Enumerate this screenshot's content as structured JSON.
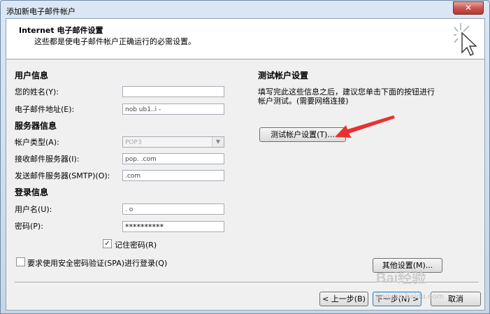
{
  "window": {
    "title": "添加新电子邮件帐户",
    "close_glyph": "✕"
  },
  "header": {
    "title": "Internet 电子邮件设置",
    "subtitle": "这些都是使电子邮件帐户正确运行的必需设置。"
  },
  "user_info": {
    "section": "用户信息",
    "name_label": "您的姓名(Y):",
    "name_value": "          ",
    "email_label": "电子邮件地址(E):",
    "email_value": "nob          ub1..i    -"
  },
  "server_info": {
    "section": "服务器信息",
    "account_type_label": "帐户类型(A):",
    "account_type_value": "POP3",
    "incoming_label": "接收邮件服务器(I):",
    "incoming_value": "pop.        .com",
    "outgoing_label": "发送邮件服务器(SMTP)(O):",
    "outgoing_value": "        .com"
  },
  "login_info": {
    "section": "登录信息",
    "username_label": "用户名(U):",
    "username_value": "               .  o",
    "password_label": "密码(P):",
    "password_value": "**********",
    "remember_label": "记住密码(R)",
    "remember_checked": "✓",
    "spa_label": "要求使用安全密码验证(SPA)进行登录(Q)"
  },
  "test": {
    "section": "测试帐户设置",
    "desc_line1": "填写完此这些信息之后，建议您单击下面的按钮进行",
    "desc_line2": "帐户测试。(需要网络连接)",
    "button": "测试帐户设置(T)..."
  },
  "buttons": {
    "more_settings": "其他设置(M)...",
    "back": "< 上一步(B)",
    "next": "下一步(N) >",
    "cancel": "取消"
  },
  "watermark": {
    "brand": "Bai",
    "suffix": "经验",
    "url": "jingyan.baidu.com"
  },
  "colors": {
    "accent_arrow": "#e8312f",
    "frame": "#c9d9ea"
  }
}
